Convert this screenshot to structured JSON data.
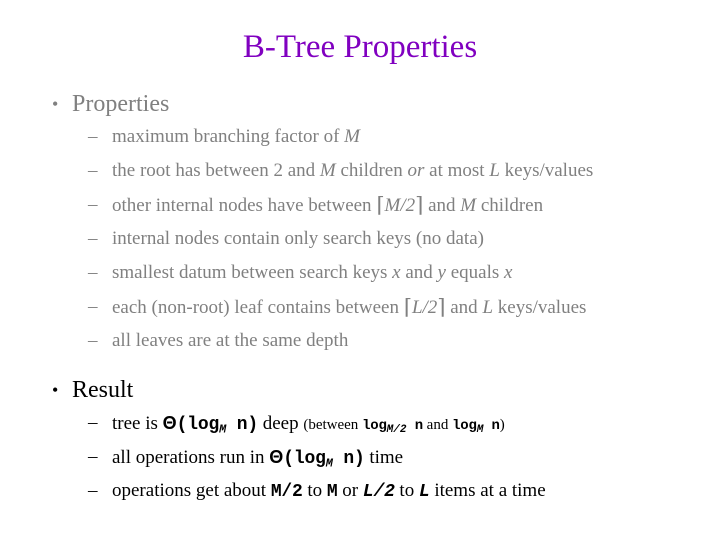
{
  "slide": {
    "title": "B-Tree Properties",
    "title_color": "#8000C0",
    "body_gray": "#808080",
    "body_black": "#000000",
    "bullet_glyph": "•",
    "dash_glyph": "–"
  },
  "groups": [
    {
      "heading": "Properties",
      "color": "gray",
      "items": [
        {
          "id": "prop-max-branching",
          "parts": [
            {
              "t": "text",
              "v": "maximum branching factor of "
            },
            {
              "t": "italic",
              "v": "M"
            }
          ]
        },
        {
          "id": "prop-root-children",
          "parts": [
            {
              "t": "text",
              "v": "the root has between 2 and "
            },
            {
              "t": "italic",
              "v": "M"
            },
            {
              "t": "text",
              "v": " children "
            },
            {
              "t": "italic",
              "v": "or"
            },
            {
              "t": "text",
              "v": " at most "
            },
            {
              "t": "italic",
              "v": "L"
            },
            {
              "t": "text",
              "v": " keys/values"
            }
          ]
        },
        {
          "id": "prop-internal-children",
          "parts": [
            {
              "t": "text",
              "v": "other internal nodes have between "
            },
            {
              "t": "ceil-open",
              "v": "⌈"
            },
            {
              "t": "italic",
              "v": "M/2"
            },
            {
              "t": "ceil-close",
              "v": "⌉"
            },
            {
              "t": "text",
              "v": " and "
            },
            {
              "t": "italic",
              "v": "M"
            },
            {
              "t": "text",
              "v": " children"
            }
          ]
        },
        {
          "id": "prop-internal-search-keys",
          "parts": [
            {
              "t": "text",
              "v": "internal nodes contain only search keys (no data)"
            }
          ]
        },
        {
          "id": "prop-smallest-datum",
          "parts": [
            {
              "t": "text",
              "v": "smallest datum between search keys "
            },
            {
              "t": "italic",
              "v": "x"
            },
            {
              "t": "text",
              "v": " and "
            },
            {
              "t": "italic",
              "v": "y"
            },
            {
              "t": "text",
              "v": " equals "
            },
            {
              "t": "italic",
              "v": "x"
            }
          ]
        },
        {
          "id": "prop-leaf-contains",
          "parts": [
            {
              "t": "text",
              "v": "each (non-root) leaf contains between "
            },
            {
              "t": "ceil-open",
              "v": "⌈"
            },
            {
              "t": "italic",
              "v": "L/2"
            },
            {
              "t": "ceil-close",
              "v": "⌉"
            },
            {
              "t": "text",
              "v": " and "
            },
            {
              "t": "italic",
              "v": "L"
            },
            {
              "t": "text",
              "v": " keys/values"
            }
          ]
        },
        {
          "id": "prop-same-depth",
          "parts": [
            {
              "t": "text",
              "v": "all leaves are at the same depth"
            }
          ]
        }
      ]
    },
    {
      "heading": "Result",
      "color": "black",
      "items": [
        {
          "id": "result-tree-depth",
          "parts": [
            {
              "t": "text",
              "v": "tree is "
            },
            {
              "t": "theta",
              "v": "Θ"
            },
            {
              "t": "mono",
              "v": "(log"
            },
            {
              "t": "sub",
              "v": "M"
            },
            {
              "t": "mono",
              "v": " n)"
            },
            {
              "t": "text",
              "v": " deep "
            },
            {
              "t": "small-open",
              "v": "(between "
            },
            {
              "t": "small-mono",
              "v": "log"
            },
            {
              "t": "small-sub",
              "v": "M/2"
            },
            {
              "t": "small-mono",
              "v": " n"
            },
            {
              "t": "small-text",
              "v": " and "
            },
            {
              "t": "small-mono",
              "v": "log"
            },
            {
              "t": "small-sub",
              "v": "M"
            },
            {
              "t": "small-mono",
              "v": " n"
            },
            {
              "t": "small-text",
              "v": ")"
            }
          ]
        },
        {
          "id": "result-operations-time",
          "parts": [
            {
              "t": "text",
              "v": "all operations run in "
            },
            {
              "t": "theta",
              "v": "Θ"
            },
            {
              "t": "mono",
              "v": "(log"
            },
            {
              "t": "sub",
              "v": "M"
            },
            {
              "t": "mono",
              "v": " n)"
            },
            {
              "t": "text",
              "v": " time"
            }
          ]
        },
        {
          "id": "result-operations-items",
          "parts": [
            {
              "t": "text",
              "v": "operations get about "
            },
            {
              "t": "mono",
              "v": "M/2"
            },
            {
              "t": "text",
              "v": " to "
            },
            {
              "t": "mono",
              "v": "M"
            },
            {
              "t": "text",
              "v": " or "
            },
            {
              "t": "mono-it",
              "v": "L/2"
            },
            {
              "t": "text",
              "v": " to "
            },
            {
              "t": "mono-it",
              "v": "L"
            },
            {
              "t": "text",
              "v": " items at a time"
            }
          ]
        }
      ]
    }
  ]
}
